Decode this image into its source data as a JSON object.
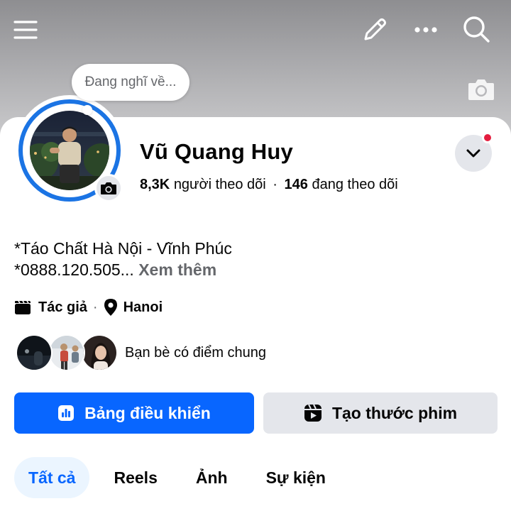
{
  "topbar": {
    "menu_icon": "menu-icon",
    "edit_icon": "pencil-icon",
    "more_icon": "more-dots-icon",
    "search_icon": "search-icon"
  },
  "cover": {
    "camera_icon": "camera-icon"
  },
  "thought_bubble": {
    "placeholder": "Đang nghĩ về..."
  },
  "profile": {
    "name": "Vũ Quang Huy",
    "followers_count": "8,3K",
    "followers_label": "người theo dõi",
    "stats_separator": "·",
    "following_count": "146",
    "following_label": "đang theo dõi"
  },
  "bio": {
    "line1": "*Táo Chất Hà Nội - Vĩnh Phúc",
    "line2": "*0888.120.505...",
    "see_more": "Xem thêm"
  },
  "meta": {
    "role": "Tác giả",
    "separator": "·",
    "location": "Hanoi"
  },
  "mutual_friends": {
    "label": "Bạn bè có điểm chung"
  },
  "buttons": {
    "dashboard": "Bảng điều khiển",
    "create_reel": "Tạo thước phim"
  },
  "tabs": [
    {
      "label": "Tất cả",
      "active": true
    },
    {
      "label": "Reels",
      "active": false
    },
    {
      "label": "Ảnh",
      "active": false
    },
    {
      "label": "Sự kiện",
      "active": false
    }
  ],
  "colors": {
    "brand_blue": "#0866ff",
    "ring_blue": "#1b74e4",
    "secondary_gray": "#e4e6eb",
    "muted_text": "#65676b",
    "notification_red": "#e41e3f"
  }
}
